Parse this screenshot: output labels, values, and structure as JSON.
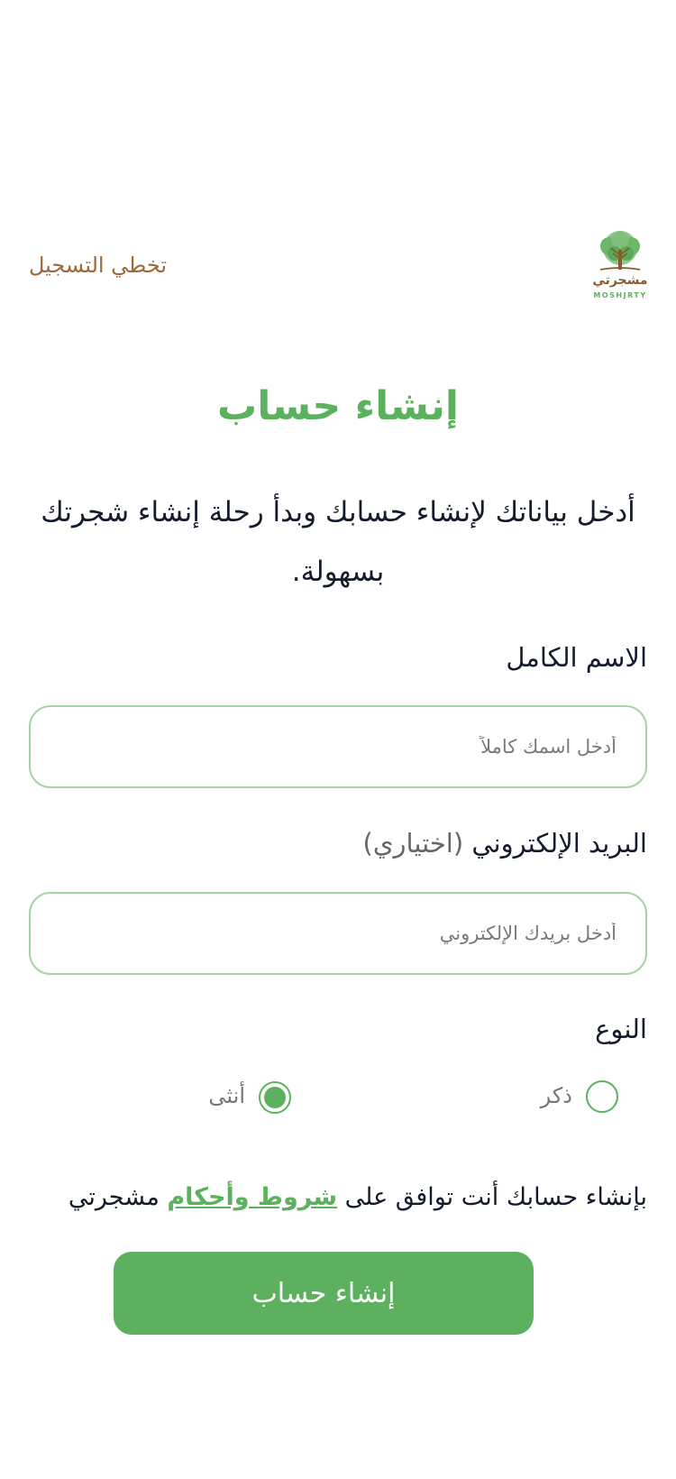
{
  "header": {
    "skip_label": "تخطي التسجيل",
    "logo_text_ar": "مشجرتي",
    "logo_text_en": "MOSHJRTY"
  },
  "title": "إنشاء حساب",
  "subtitle": "أدخل بياناتك لإنشاء حسابك وبدأ رحلة إنشاء شجرتك بسهولة.",
  "form": {
    "full_name": {
      "label": "الاسم الكامل",
      "placeholder": "أدخل اسمك كاملاً",
      "value": ""
    },
    "email": {
      "label": "البريد الإلكتروني",
      "optional": "(اختياري)",
      "placeholder": "أدخل بريدك الإلكتروني",
      "value": ""
    },
    "gender": {
      "label": "النوع",
      "options": [
        {
          "label": "ذكر",
          "selected": false
        },
        {
          "label": "أنثى",
          "selected": true
        }
      ]
    }
  },
  "terms": {
    "prefix": "بإنشاء حسابك أنت توافق على ",
    "link": "شروط وأحكام",
    "suffix": " مشجرتي"
  },
  "submit_label": "إنشاء حساب",
  "colors": {
    "accent": "#5cb15e",
    "brown": "#9a6a3a",
    "text": "#141b2d",
    "field_border": "#a6d4a5"
  },
  "icons": {
    "logo": "tree-logo-icon"
  }
}
